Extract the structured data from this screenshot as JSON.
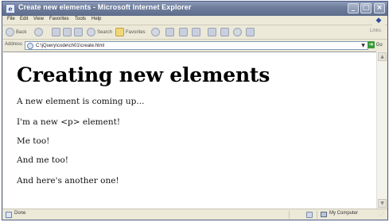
{
  "window": {
    "title": "Create new elements - Microsoft Internet Explorer",
    "buttons": {
      "minimize": "_",
      "maximize": "□",
      "close": "×"
    }
  },
  "menubar": {
    "items": [
      "File",
      "Edit",
      "View",
      "Favorites",
      "Tools",
      "Help"
    ]
  },
  "toolbar": {
    "back_label": "Back",
    "search_label": "Search",
    "favorites_label": "Favorites",
    "links_label": "Links"
  },
  "addressbar": {
    "label": "Address",
    "url": "C:\\jQuery\\code\\ch01\\create.html",
    "go_label": "Go"
  },
  "page": {
    "heading": "Creating new elements",
    "paragraphs": [
      "A new element is coming up...",
      "I'm a new <p> element!",
      "Me too!",
      "And me too!",
      "And here's another one!"
    ]
  },
  "statusbar": {
    "status": "Done",
    "zone": "My Computer"
  },
  "icons": [
    "ie-icon",
    "back-icon",
    "forward-icon",
    "stop-icon",
    "refresh-icon",
    "home-icon",
    "search-icon",
    "favorites-icon",
    "media-icon",
    "mail-icon",
    "print-icon",
    "edit-icon",
    "discuss-icon",
    "messenger-icon",
    "go-icon",
    "computer-icon"
  ]
}
